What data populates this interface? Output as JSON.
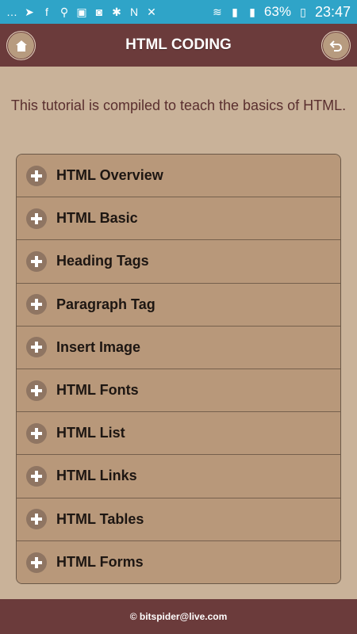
{
  "status_bar": {
    "battery": "63%",
    "time": "23:47",
    "icons": [
      "messages-icon",
      "location-icon",
      "facebook-icon",
      "usb-icon",
      "image-icon",
      "camera-icon",
      "bluetooth-icon",
      "nfc-icon",
      "mute-icon",
      "wifi-icon",
      "signal-3g-icon",
      "signal-4g-icon",
      "battery-icon"
    ]
  },
  "app_bar": {
    "title": "HTML CODING",
    "home_icon": "home-icon",
    "back_icon": "back-icon"
  },
  "intro": {
    "text": "This tutorial is compiled to teach the basics of HTML."
  },
  "menu": {
    "items": [
      {
        "label": "HTML Overview"
      },
      {
        "label": "HTML Basic"
      },
      {
        "label": "Heading Tags"
      },
      {
        "label": "Paragraph Tag"
      },
      {
        "label": "Insert Image"
      },
      {
        "label": "HTML Fonts"
      },
      {
        "label": "HTML List"
      },
      {
        "label": "HTML Links"
      },
      {
        "label": "HTML Tables"
      },
      {
        "label": "HTML Forms"
      }
    ]
  },
  "footer": {
    "text": "© bitspider@live.com"
  },
  "colors": {
    "header": "#6b3b3b",
    "background": "#c9b299",
    "menu_item": "#b8987a",
    "status_bar": "#2fa4c8"
  }
}
